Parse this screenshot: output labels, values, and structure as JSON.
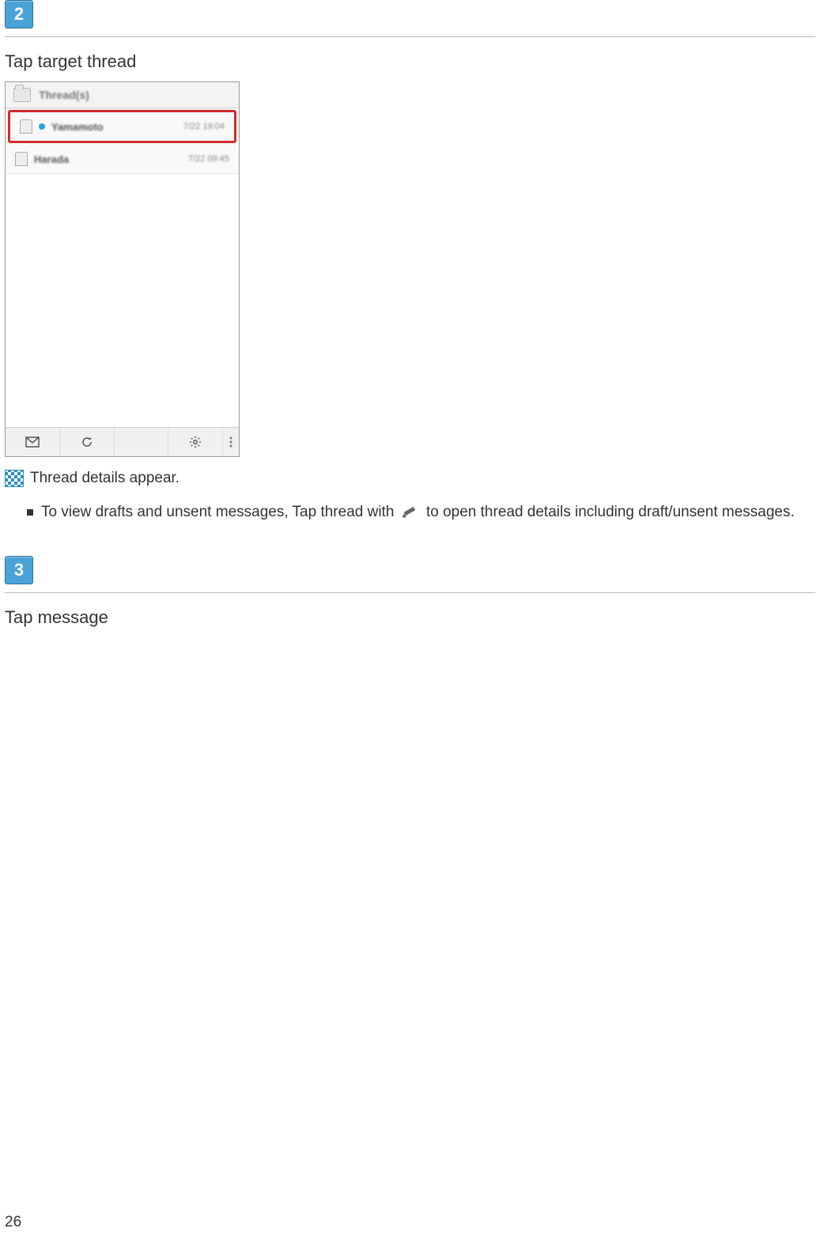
{
  "steps": {
    "two": {
      "badge": "2",
      "title": "Tap target thread"
    },
    "three": {
      "badge": "3",
      "title": "Tap message"
    }
  },
  "phone": {
    "header": "Thread(s)",
    "threads": [
      {
        "name": "Yamamoto",
        "time": "7/22 19:04"
      },
      {
        "name": "Harada",
        "time": "7/22 09:45"
      }
    ]
  },
  "result_text": "Thread details appear.",
  "note": {
    "before_icon": "To view drafts and unsent messages, Tap thread with",
    "after_icon": "to open thread details including draft/unsent messages."
  },
  "page_number": "26"
}
